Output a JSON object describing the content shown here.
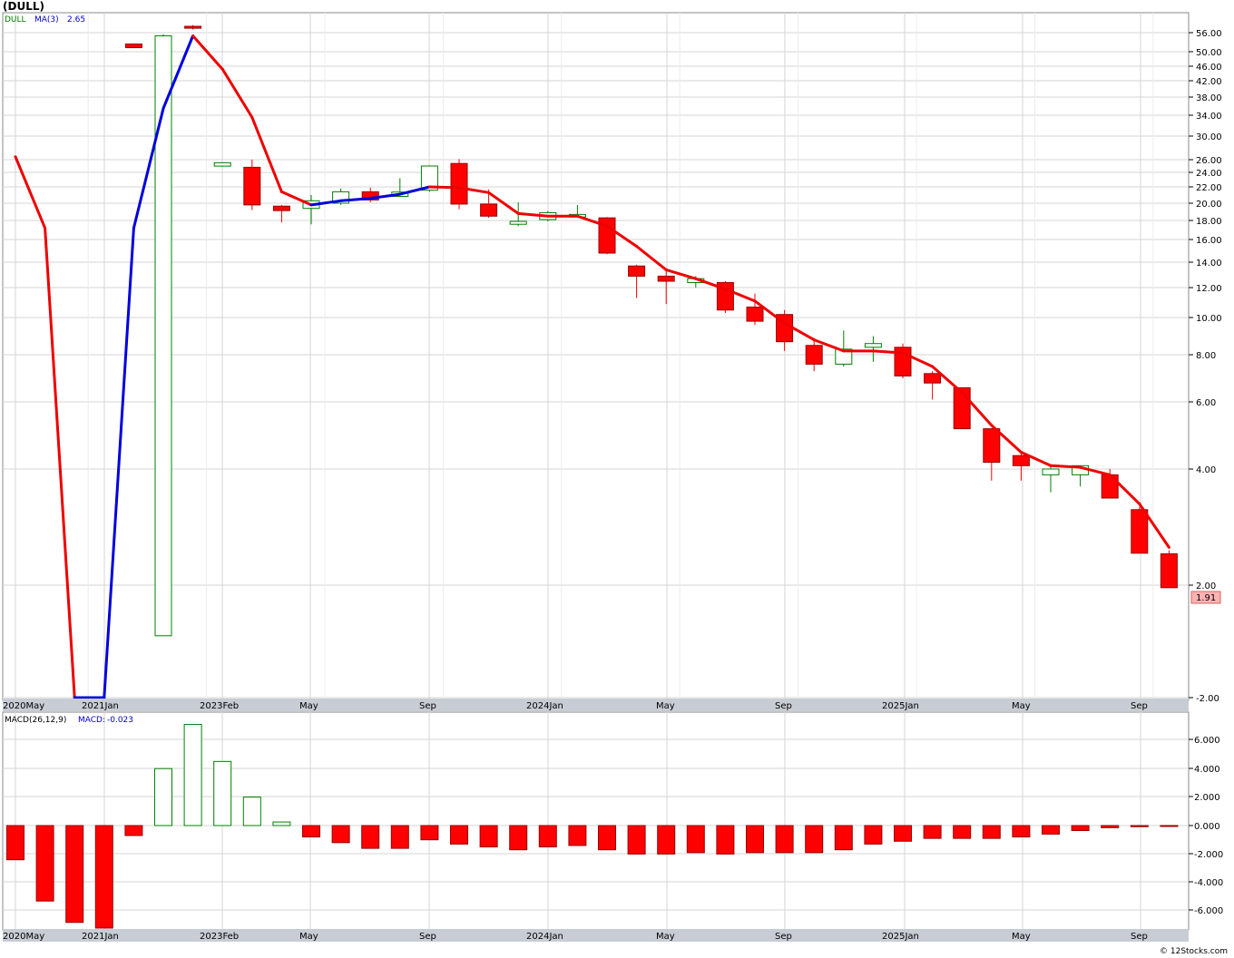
{
  "page_title": "(DULL)",
  "footer": "© 12Stocks.com",
  "colors": {
    "down": "#ff0000",
    "up": "#008000",
    "ma_up": "#0000dd",
    "ma_down": "#ee0000",
    "last_price_bg": "#ffb3b3"
  },
  "chart_data": [
    {
      "type": "candlestick",
      "ticker_label": "DULL",
      "indicator_label": "MA(3)",
      "indicator_value": "2.65",
      "scale": "log",
      "y_ticks": [
        56,
        50,
        46,
        42,
        38,
        34,
        30,
        26,
        24,
        22,
        20,
        18,
        16,
        14,
        12,
        10,
        8,
        6,
        4,
        2,
        -2
      ],
      "y_tick_labels": [
        "56.00",
        "50.00",
        "46.00",
        "42.00",
        "38.00",
        "34.00",
        "30.00",
        "26.00",
        "24.00",
        "22.00",
        "20.00",
        "18.00",
        "16.00",
        "14.00",
        "12.00",
        "10.00",
        "8.00",
        "6.00",
        "4.00",
        "2.00",
        "-2.00"
      ],
      "last_price": "1.91",
      "x_labels": [
        "2020May",
        "2021Jan",
        "2023Feb",
        "May",
        "Sep",
        "2024Jan",
        "May",
        "Sep",
        "2025Jan",
        "May",
        "Sep"
      ],
      "candles": [
        {
          "o": null,
          "h": null,
          "l": null,
          "c": null
        },
        {
          "o": null,
          "h": null,
          "l": null,
          "c": null
        },
        {
          "o": null,
          "h": null,
          "l": null,
          "c": null
        },
        {
          "o": null,
          "h": null,
          "l": null,
          "c": null
        },
        {
          "o": 52,
          "h": 52.3,
          "l": 51.2,
          "c": 51.7
        },
        {
          "o": 0.2,
          "h": 55.5,
          "l": 0.2,
          "c": 55
        },
        {
          "o": 58,
          "h": 58.4,
          "l": 57,
          "c": 57.4
        },
        {
          "o": 25.2,
          "h": 25.6,
          "l": 24.9,
          "c": 25.3
        },
        {
          "o": 24.8,
          "h": 26,
          "l": 19.2,
          "c": 19.8
        },
        {
          "o": 19.5,
          "h": 19.8,
          "l": 17.8,
          "c": 19.3
        },
        {
          "o": 19.4,
          "h": 21,
          "l": 17.6,
          "c": 20.3
        },
        {
          "o": 20,
          "h": 21.8,
          "l": 19.8,
          "c": 21.4
        },
        {
          "o": 21.4,
          "h": 21.9,
          "l": 20.1,
          "c": 20.4
        },
        {
          "o": 21,
          "h": 23.2,
          "l": 20.8,
          "c": 21.2
        },
        {
          "o": 21.6,
          "h": 25.1,
          "l": 21.4,
          "c": 25
        },
        {
          "o": 25.4,
          "h": 26.1,
          "l": 19.3,
          "c": 19.9
        },
        {
          "o": 19.9,
          "h": 21.7,
          "l": 18.3,
          "c": 18.5
        },
        {
          "o": 17.6,
          "h": 20.1,
          "l": 17.4,
          "c": 17.9
        },
        {
          "o": 18.1,
          "h": 19.1,
          "l": 17.9,
          "c": 18.9
        },
        {
          "o": 18.4,
          "h": 19.8,
          "l": 18.3,
          "c": 18.7
        },
        {
          "o": 18.3,
          "h": 18.4,
          "l": 14.7,
          "c": 14.8
        },
        {
          "o": 13.7,
          "h": 13.8,
          "l": 11.3,
          "c": 12.9
        },
        {
          "o": 12.9,
          "h": 13.5,
          "l": 10.9,
          "c": 12.5
        },
        {
          "o": 12.5,
          "h": 12.9,
          "l": 12,
          "c": 12.6
        },
        {
          "o": 12.4,
          "h": 12.5,
          "l": 10.3,
          "c": 10.5
        },
        {
          "o": 10.7,
          "h": 11.6,
          "l": 9.6,
          "c": 9.8
        },
        {
          "o": 10.2,
          "h": 10.5,
          "l": 8.2,
          "c": 8.7
        },
        {
          "o": 8.5,
          "h": 8.9,
          "l": 7.3,
          "c": 7.6
        },
        {
          "o": 7.6,
          "h": 9.3,
          "l": 7.5,
          "c": 8.3
        },
        {
          "o": 8.4,
          "h": 9,
          "l": 7.7,
          "c": 8.6
        },
        {
          "o": 8.4,
          "h": 8.6,
          "l": 7,
          "c": 7.1
        },
        {
          "o": 7.2,
          "h": 7.3,
          "l": 6.1,
          "c": 6.8
        },
        {
          "o": 6.6,
          "h": 6.6,
          "l": 5.2,
          "c": 5.2
        },
        {
          "o": 5.2,
          "h": 5.2,
          "l": 3.8,
          "c": 4.2
        },
        {
          "o": 4.4,
          "h": 4.5,
          "l": 3.8,
          "c": 4.1
        },
        {
          "o": 3.9,
          "h": 4.1,
          "l": 3.6,
          "c": 4.0
        },
        {
          "o": 3.9,
          "h": 4.1,
          "l": 3.7,
          "c": 4.1
        },
        {
          "o": 3.9,
          "h": 4.0,
          "l": 3.5,
          "c": 3.5
        },
        {
          "o": 3.3,
          "h": 3.35,
          "l": 2.55,
          "c": 2.55
        },
        {
          "o": 2.54,
          "h": 2.6,
          "l": 1.91,
          "c": 1.91
        }
      ],
      "ma_points": [
        {
          "i": 0,
          "v": 26.5,
          "c": "down"
        },
        {
          "i": 1,
          "v": 17.2,
          "c": "down"
        },
        {
          "i": 2,
          "v": -2,
          "c": "down"
        },
        {
          "i": 3,
          "v": -2,
          "c": "up"
        },
        {
          "i": 4,
          "v": 17.2,
          "c": "up"
        },
        {
          "i": 5,
          "v": 35.5,
          "c": "up"
        },
        {
          "i": 6,
          "v": 55,
          "c": "up"
        },
        {
          "i": 7,
          "v": 45.2,
          "c": "down"
        },
        {
          "i": 8,
          "v": 33.6,
          "c": "down"
        },
        {
          "i": 9,
          "v": 21.4,
          "c": "down"
        },
        {
          "i": 10,
          "v": 19.8,
          "c": "down"
        },
        {
          "i": 11,
          "v": 20.3,
          "c": "up"
        },
        {
          "i": 12,
          "v": 20.6,
          "c": "up"
        },
        {
          "i": 13,
          "v": 21.1,
          "c": "up"
        },
        {
          "i": 14,
          "v": 22,
          "c": "up"
        },
        {
          "i": 15,
          "v": 21.9,
          "c": "down"
        },
        {
          "i": 16,
          "v": 21.3,
          "c": "down"
        },
        {
          "i": 17,
          "v": 18.8,
          "c": "down"
        },
        {
          "i": 18,
          "v": 18.5,
          "c": "down"
        },
        {
          "i": 19,
          "v": 18.5,
          "c": "down"
        },
        {
          "i": 20,
          "v": 17.4,
          "c": "down"
        },
        {
          "i": 21,
          "v": 15.4,
          "c": "down"
        },
        {
          "i": 22,
          "v": 13.4,
          "c": "down"
        },
        {
          "i": 23,
          "v": 12.7,
          "c": "down"
        },
        {
          "i": 24,
          "v": 11.9,
          "c": "down"
        },
        {
          "i": 25,
          "v": 11.1,
          "c": "down"
        },
        {
          "i": 26,
          "v": 9.7,
          "c": "down"
        },
        {
          "i": 27,
          "v": 8.8,
          "c": "down"
        },
        {
          "i": 28,
          "v": 8.2,
          "c": "down"
        },
        {
          "i": 29,
          "v": 8.2,
          "c": "down"
        },
        {
          "i": 30,
          "v": 8.1,
          "c": "down"
        },
        {
          "i": 31,
          "v": 7.5,
          "c": "down"
        },
        {
          "i": 32,
          "v": 6.4,
          "c": "down"
        },
        {
          "i": 33,
          "v": 5.3,
          "c": "down"
        },
        {
          "i": 34,
          "v": 4.5,
          "c": "down"
        },
        {
          "i": 35,
          "v": 4.1,
          "c": "down"
        },
        {
          "i": 36,
          "v": 4.05,
          "c": "down"
        },
        {
          "i": 37,
          "v": 3.9,
          "c": "down"
        },
        {
          "i": 38,
          "v": 3.4,
          "c": "down"
        },
        {
          "i": 39,
          "v": 2.65,
          "c": "down"
        }
      ]
    },
    {
      "type": "bar",
      "indicator_label": "MACD(26,12,9)",
      "value_label": "MACD:",
      "value": "-0.023",
      "y_ticks": [
        6,
        4,
        2,
        0,
        -2,
        -4,
        -6
      ],
      "y_tick_labels": [
        "6.000",
        "4.000",
        "2.000",
        "0.000",
        "-2.000",
        "-4.000",
        "-6.000"
      ],
      "ylim": [
        -7.3,
        7.2
      ],
      "x_labels": [
        "2020May",
        "2021Jan",
        "2023Feb",
        "May",
        "Sep",
        "2024Jan",
        "May",
        "Sep",
        "2025Jan",
        "May",
        "Sep"
      ],
      "values": [
        -2.4,
        -5.3,
        -6.8,
        -7.5,
        -0.7,
        4.0,
        7.1,
        4.5,
        2.0,
        0.25,
        -0.8,
        -1.2,
        -1.6,
        -1.6,
        -1.0,
        -1.3,
        -1.5,
        -1.7,
        -1.5,
        -1.4,
        -1.7,
        -2.0,
        -2.0,
        -1.9,
        -2.0,
        -1.9,
        -1.9,
        -1.9,
        -1.7,
        -1.3,
        -1.1,
        -0.9,
        -0.9,
        -0.9,
        -0.8,
        -0.6,
        -0.35,
        -0.15,
        -0.08,
        -0.023
      ]
    }
  ]
}
